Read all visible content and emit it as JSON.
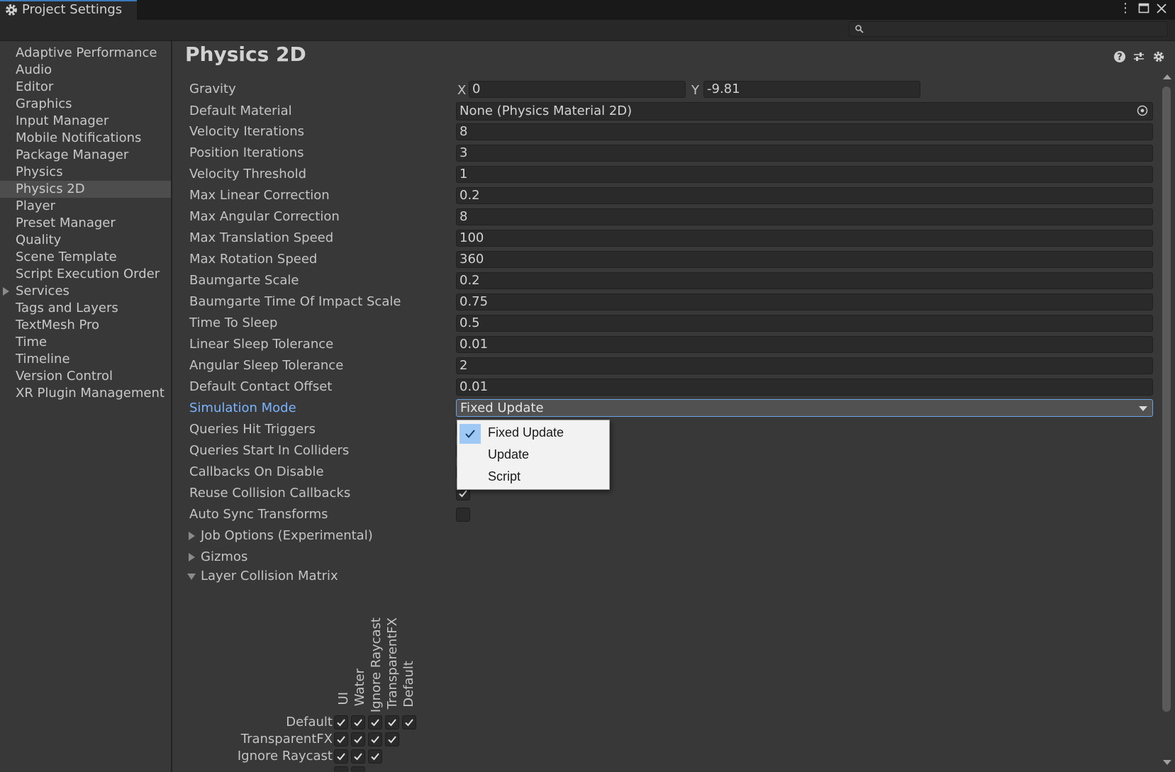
{
  "window": {
    "title": "Project Settings",
    "icon": "gear-icon",
    "controls": [
      "more-icon",
      "maximize-icon",
      "close-icon"
    ]
  },
  "search": {
    "placeholder": "",
    "value": ""
  },
  "sidebar": {
    "items": [
      {
        "label": "Adaptive Performance"
      },
      {
        "label": "Audio"
      },
      {
        "label": "Editor"
      },
      {
        "label": "Graphics"
      },
      {
        "label": "Input Manager"
      },
      {
        "label": "Mobile Notifications"
      },
      {
        "label": "Package Manager"
      },
      {
        "label": "Physics"
      },
      {
        "label": "Physics 2D",
        "selected": true
      },
      {
        "label": "Player"
      },
      {
        "label": "Preset Manager"
      },
      {
        "label": "Quality"
      },
      {
        "label": "Scene Template"
      },
      {
        "label": "Script Execution Order"
      },
      {
        "label": "Services",
        "expandable": true
      },
      {
        "label": "Tags and Layers"
      },
      {
        "label": "TextMesh Pro"
      },
      {
        "label": "Time"
      },
      {
        "label": "Timeline"
      },
      {
        "label": "Version Control"
      },
      {
        "label": "XR Plugin Management"
      }
    ]
  },
  "main": {
    "title": "Physics 2D",
    "header_icons": [
      "help-icon",
      "presets-icon",
      "settings-gear-icon"
    ],
    "gravity": {
      "label": "Gravity",
      "x_label": "X",
      "x": "0",
      "y_label": "Y",
      "y": "-9.81"
    },
    "default_material": {
      "label": "Default Material",
      "value": "None (Physics Material 2D)"
    },
    "fields": [
      {
        "label": "Velocity Iterations",
        "value": "8"
      },
      {
        "label": "Position Iterations",
        "value": "3"
      },
      {
        "label": "Velocity Threshold",
        "value": "1"
      },
      {
        "label": "Max Linear Correction",
        "value": "0.2"
      },
      {
        "label": "Max Angular Correction",
        "value": "8"
      },
      {
        "label": "Max Translation Speed",
        "value": "100"
      },
      {
        "label": "Max Rotation Speed",
        "value": "360"
      },
      {
        "label": "Baumgarte Scale",
        "value": "0.2"
      },
      {
        "label": "Baumgarte Time Of Impact Scale",
        "value": "0.75"
      },
      {
        "label": "Time To Sleep",
        "value": "0.5"
      },
      {
        "label": "Linear Sleep Tolerance",
        "value": "0.01"
      },
      {
        "label": "Angular Sleep Tolerance",
        "value": "2"
      },
      {
        "label": "Default Contact Offset",
        "value": "0.01"
      }
    ],
    "simulation_mode": {
      "label": "Simulation Mode",
      "value": "Fixed Update",
      "options": [
        {
          "label": "Fixed Update",
          "checked": true
        },
        {
          "label": "Update",
          "checked": false
        },
        {
          "label": "Script",
          "checked": false
        }
      ]
    },
    "toggles": [
      {
        "label": "Queries Hit Triggers",
        "checked": true
      },
      {
        "label": "Queries Start In Colliders",
        "checked": true
      },
      {
        "label": "Callbacks On Disable",
        "checked": true
      },
      {
        "label": "Reuse Collision Callbacks",
        "checked": true
      },
      {
        "label": "Auto Sync Transforms",
        "checked": false
      }
    ],
    "foldouts": [
      {
        "label": "Job Options (Experimental)",
        "expanded": false
      },
      {
        "label": "Gizmos",
        "expanded": false
      },
      {
        "label": "Layer Collision Matrix",
        "expanded": true
      }
    ],
    "collision_matrix": {
      "columns": [
        "Default",
        "TransparentFX",
        "Ignore Raycast",
        "Water",
        "UI"
      ],
      "rows": [
        {
          "label": "Default",
          "checks": [
            true,
            true,
            true,
            true,
            true
          ]
        },
        {
          "label": "TransparentFX",
          "checks": [
            true,
            true,
            true,
            true
          ]
        },
        {
          "label": "Ignore Raycast",
          "checks": [
            true,
            true,
            true
          ]
        }
      ]
    }
  },
  "colors": {
    "background": "#383838",
    "accent": "#7ab3ff",
    "field_bg": "#2a2a2a",
    "menu_bg": "#f2f2f2",
    "menu_check_bg": "#9ec9f5"
  }
}
